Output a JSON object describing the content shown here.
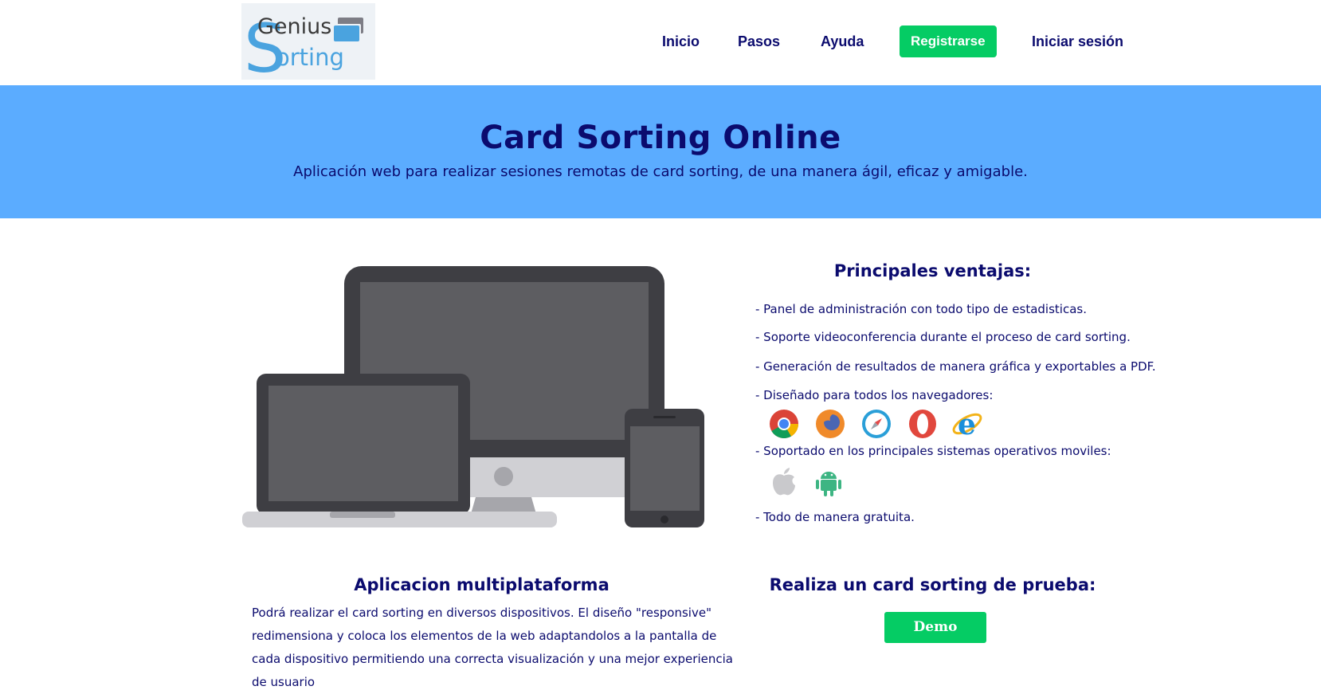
{
  "logo": {
    "line1": "Genius",
    "line2": "orting",
    "initial": "S"
  },
  "nav": {
    "items": [
      {
        "label": "Inicio"
      },
      {
        "label": "Pasos"
      },
      {
        "label": "Ayuda"
      }
    ],
    "register_label": "Registrarse",
    "login_label": "Iniciar sesión"
  },
  "hero": {
    "title": "Card Sorting Online",
    "subtitle": "Aplicación web para realizar sesiones remotas de card sorting, de una manera ágil, eficaz y amigable."
  },
  "advantages": {
    "title": "Principales ventajas:",
    "items": [
      "- Panel de administración con todo tipo de estadisticas.",
      "- Soporte videoconferencia durante el proceso de card sorting.",
      "- Generación de resultados de manera gráfica y exportables a PDF.",
      "- Diseñado para todos los navegadores:",
      "- Soportado en los principales sistemas operativos moviles:",
      "- Todo de manera gratuita."
    ],
    "browsers": [
      "chrome-icon",
      "firefox-icon",
      "safari-icon",
      "opera-icon",
      "internet-explorer-icon"
    ],
    "mobile_os": [
      "apple-icon",
      "android-icon"
    ]
  },
  "multiplatform": {
    "title": "Aplicacion multiplataforma",
    "text": "Podrá realizar el card sorting en diversos dispositivos.  El diseño \"responsive\" redimensiona y coloca los elementos de la web adaptandolos a la pantalla de cada dispositivo permitiendo una correcta visualización y una mejor experiencia de usuario"
  },
  "demo": {
    "title": "Realiza un card sorting de prueba:",
    "button_label": "Demo"
  },
  "colors": {
    "navy": "#0b0b6e",
    "hero_bg": "#5bacff",
    "green": "#05cc64"
  }
}
